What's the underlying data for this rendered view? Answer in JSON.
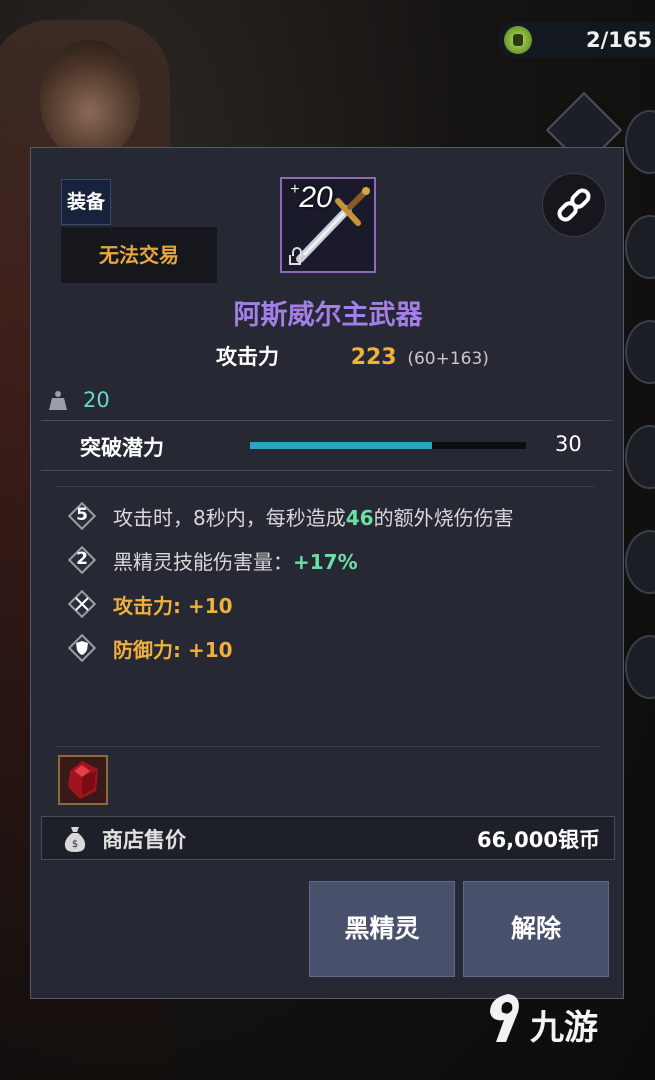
{
  "top_counter": {
    "icon": "coin-icon",
    "text": "2/165"
  },
  "item": {
    "category_tag": "装备",
    "trade_status": "无法交易",
    "enhance_level": "20",
    "enhance_plus": "+",
    "name": "阿斯威尔主武器",
    "name_color": "#a57fe8",
    "attack_label": "攻击力",
    "attack_total": "223",
    "attack_detail": "(60+163)",
    "weight": "20"
  },
  "potential": {
    "label": "突破潜力",
    "value": "30",
    "fill_fraction": 0.66,
    "bar_color": "#28a4c4"
  },
  "effects": [
    {
      "badge": "5",
      "text_before": "攻击时，8秒内，每秒造成",
      "highlight": "46",
      "text_after": "的额外烧伤伤害"
    },
    {
      "badge": "2",
      "text_before": "黑精灵技能伤害量：",
      "highlight": "+17%",
      "text_after": ""
    },
    {
      "badge_icon": "crossed-swords-icon",
      "text": "攻击力: +10"
    },
    {
      "badge_icon": "shield-icon",
      "text": "防御力: +10"
    }
  ],
  "shop": {
    "label": "商店售价",
    "value": "66,000银币"
  },
  "buttons": {
    "black_spirit": "黑精灵",
    "remove": "解除"
  },
  "watermark": {
    "text": "九游"
  }
}
